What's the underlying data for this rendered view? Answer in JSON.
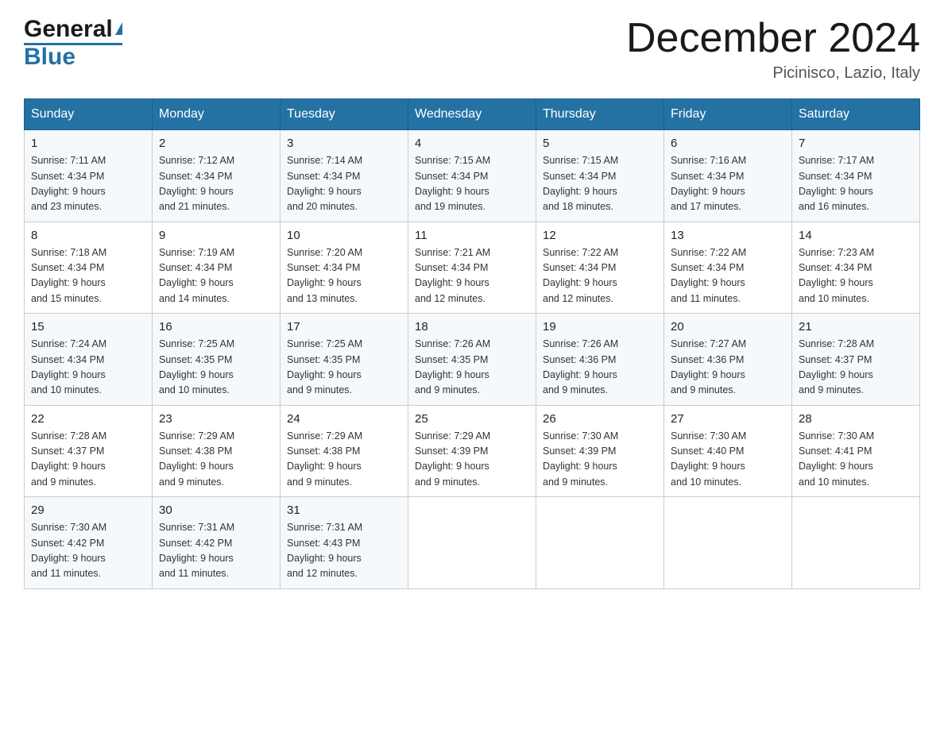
{
  "header": {
    "logo_general": "General",
    "logo_blue": "Blue",
    "month_title": "December 2024",
    "location": "Picinisco, Lazio, Italy"
  },
  "weekdays": [
    "Sunday",
    "Monday",
    "Tuesday",
    "Wednesday",
    "Thursday",
    "Friday",
    "Saturday"
  ],
  "weeks": [
    [
      {
        "day": "1",
        "sunrise": "7:11 AM",
        "sunset": "4:34 PM",
        "daylight": "9 hours and 23 minutes."
      },
      {
        "day": "2",
        "sunrise": "7:12 AM",
        "sunset": "4:34 PM",
        "daylight": "9 hours and 21 minutes."
      },
      {
        "day": "3",
        "sunrise": "7:14 AM",
        "sunset": "4:34 PM",
        "daylight": "9 hours and 20 minutes."
      },
      {
        "day": "4",
        "sunrise": "7:15 AM",
        "sunset": "4:34 PM",
        "daylight": "9 hours and 19 minutes."
      },
      {
        "day": "5",
        "sunrise": "7:15 AM",
        "sunset": "4:34 PM",
        "daylight": "9 hours and 18 minutes."
      },
      {
        "day": "6",
        "sunrise": "7:16 AM",
        "sunset": "4:34 PM",
        "daylight": "9 hours and 17 minutes."
      },
      {
        "day": "7",
        "sunrise": "7:17 AM",
        "sunset": "4:34 PM",
        "daylight": "9 hours and 16 minutes."
      }
    ],
    [
      {
        "day": "8",
        "sunrise": "7:18 AM",
        "sunset": "4:34 PM",
        "daylight": "9 hours and 15 minutes."
      },
      {
        "day": "9",
        "sunrise": "7:19 AM",
        "sunset": "4:34 PM",
        "daylight": "9 hours and 14 minutes."
      },
      {
        "day": "10",
        "sunrise": "7:20 AM",
        "sunset": "4:34 PM",
        "daylight": "9 hours and 13 minutes."
      },
      {
        "day": "11",
        "sunrise": "7:21 AM",
        "sunset": "4:34 PM",
        "daylight": "9 hours and 12 minutes."
      },
      {
        "day": "12",
        "sunrise": "7:22 AM",
        "sunset": "4:34 PM",
        "daylight": "9 hours and 12 minutes."
      },
      {
        "day": "13",
        "sunrise": "7:22 AM",
        "sunset": "4:34 PM",
        "daylight": "9 hours and 11 minutes."
      },
      {
        "day": "14",
        "sunrise": "7:23 AM",
        "sunset": "4:34 PM",
        "daylight": "9 hours and 10 minutes."
      }
    ],
    [
      {
        "day": "15",
        "sunrise": "7:24 AM",
        "sunset": "4:34 PM",
        "daylight": "9 hours and 10 minutes."
      },
      {
        "day": "16",
        "sunrise": "7:25 AM",
        "sunset": "4:35 PM",
        "daylight": "9 hours and 10 minutes."
      },
      {
        "day": "17",
        "sunrise": "7:25 AM",
        "sunset": "4:35 PM",
        "daylight": "9 hours and 9 minutes."
      },
      {
        "day": "18",
        "sunrise": "7:26 AM",
        "sunset": "4:35 PM",
        "daylight": "9 hours and 9 minutes."
      },
      {
        "day": "19",
        "sunrise": "7:26 AM",
        "sunset": "4:36 PM",
        "daylight": "9 hours and 9 minutes."
      },
      {
        "day": "20",
        "sunrise": "7:27 AM",
        "sunset": "4:36 PM",
        "daylight": "9 hours and 9 minutes."
      },
      {
        "day": "21",
        "sunrise": "7:28 AM",
        "sunset": "4:37 PM",
        "daylight": "9 hours and 9 minutes."
      }
    ],
    [
      {
        "day": "22",
        "sunrise": "7:28 AM",
        "sunset": "4:37 PM",
        "daylight": "9 hours and 9 minutes."
      },
      {
        "day": "23",
        "sunrise": "7:29 AM",
        "sunset": "4:38 PM",
        "daylight": "9 hours and 9 minutes."
      },
      {
        "day": "24",
        "sunrise": "7:29 AM",
        "sunset": "4:38 PM",
        "daylight": "9 hours and 9 minutes."
      },
      {
        "day": "25",
        "sunrise": "7:29 AM",
        "sunset": "4:39 PM",
        "daylight": "9 hours and 9 minutes."
      },
      {
        "day": "26",
        "sunrise": "7:30 AM",
        "sunset": "4:39 PM",
        "daylight": "9 hours and 9 minutes."
      },
      {
        "day": "27",
        "sunrise": "7:30 AM",
        "sunset": "4:40 PM",
        "daylight": "9 hours and 10 minutes."
      },
      {
        "day": "28",
        "sunrise": "7:30 AM",
        "sunset": "4:41 PM",
        "daylight": "9 hours and 10 minutes."
      }
    ],
    [
      {
        "day": "29",
        "sunrise": "7:30 AM",
        "sunset": "4:42 PM",
        "daylight": "9 hours and 11 minutes."
      },
      {
        "day": "30",
        "sunrise": "7:31 AM",
        "sunset": "4:42 PM",
        "daylight": "9 hours and 11 minutes."
      },
      {
        "day": "31",
        "sunrise": "7:31 AM",
        "sunset": "4:43 PM",
        "daylight": "9 hours and 12 minutes."
      },
      null,
      null,
      null,
      null
    ]
  ],
  "labels": {
    "sunrise": "Sunrise:",
    "sunset": "Sunset:",
    "daylight": "Daylight:"
  }
}
